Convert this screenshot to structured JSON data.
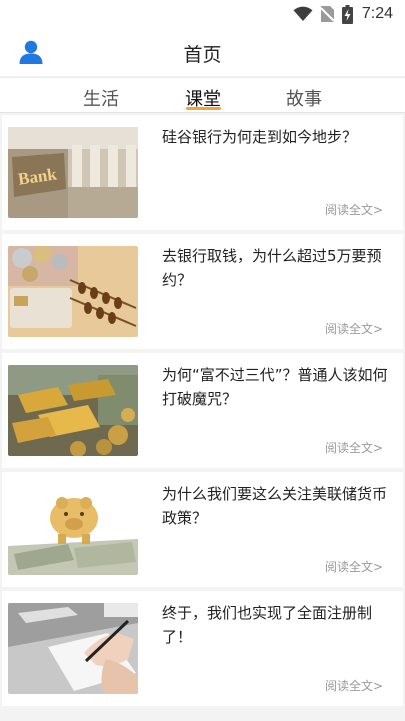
{
  "status_bar": {
    "time": "7:24",
    "icons": [
      "wifi-icon",
      "no-sim-icon",
      "battery-charging-icon"
    ]
  },
  "header": {
    "title": "首页",
    "left_icon": "user-icon"
  },
  "tabs": [
    {
      "label": "生活",
      "active": false
    },
    {
      "label": "课堂",
      "active": true
    },
    {
      "label": "故事",
      "active": false
    }
  ],
  "accent_color": "#f2a33a",
  "articles": [
    {
      "title": "硅谷银行为何走到如今地步？",
      "thumbnail": "bank-building-image",
      "action": "阅读全文>"
    },
    {
      "title": "去银行取钱，为什么超过5万要预约？",
      "thumbnail": "coins-and-abacus-image",
      "action": "阅读全文>"
    },
    {
      "title": "为何“富不过三代”？普通人该如何打破魔咒？",
      "thumbnail": "gold-bars-image",
      "action": "阅读全文>"
    },
    {
      "title": "为什么我们要这么关注美联储货币政策？",
      "thumbnail": "piggy-bank-image",
      "action": "阅读全文>"
    },
    {
      "title": "终于，我们也实现了全面注册制了！",
      "thumbnail": "signing-document-image",
      "action": "阅读全文>"
    }
  ]
}
